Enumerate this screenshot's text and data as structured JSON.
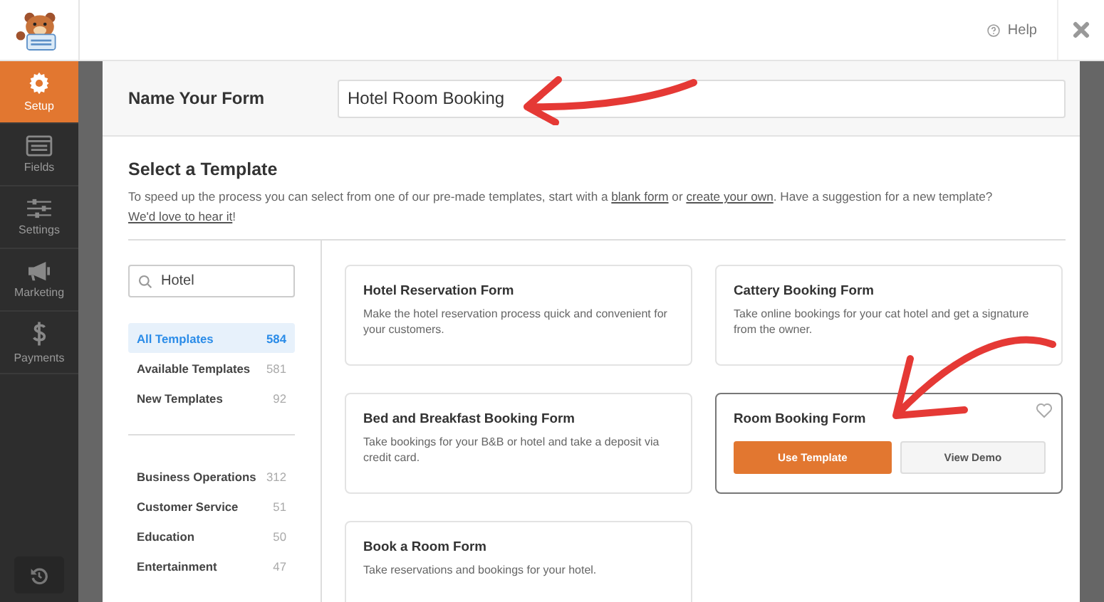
{
  "header": {
    "help": "Help"
  },
  "nav": [
    {
      "label": "Setup",
      "selected": true
    },
    {
      "label": "Fields",
      "selected": false
    },
    {
      "label": "Settings",
      "selected": false
    },
    {
      "label": "Marketing",
      "selected": false
    },
    {
      "label": "Payments",
      "selected": false
    }
  ],
  "name_form": {
    "label": "Name Your Form",
    "value": "Hotel Room Booking"
  },
  "template_section": {
    "title": "Select a Template",
    "description": [
      {
        "kind": "text",
        "text": "To speed up the process you can select from one of our pre-made templates, start with a "
      },
      {
        "kind": "link",
        "text": "blank form"
      },
      {
        "kind": "text",
        "text": " or "
      },
      {
        "kind": "link",
        "text": "create your own"
      },
      {
        "kind": "text",
        "text": ". Have a suggestion for a new template? "
      },
      {
        "kind": "link",
        "text": "We'd love to hear it"
      },
      {
        "kind": "text",
        "text": "!"
      }
    ]
  },
  "search": {
    "value": "Hotel"
  },
  "filters": [
    {
      "label": "All Templates",
      "count": "584",
      "selected": true
    },
    {
      "label": "Available Templates",
      "count": "581",
      "selected": false
    },
    {
      "label": "New Templates",
      "count": "92",
      "selected": false
    }
  ],
  "categories": [
    {
      "label": "Business Operations",
      "count": "312",
      "selected": false
    },
    {
      "label": "Customer Service",
      "count": "51",
      "selected": false
    },
    {
      "label": "Education",
      "count": "50",
      "selected": false
    },
    {
      "label": "Entertainment",
      "count": "47",
      "selected": false
    }
  ],
  "templates": [
    {
      "title": "Hotel Reservation Form",
      "description": "Make the hotel reservation process quick and convenient for your customers.",
      "hovered": false
    },
    {
      "title": "Cattery Booking Form",
      "description": "Take online bookings for your cat hotel and get a signature from the owner.",
      "hovered": false
    },
    {
      "title": "Bed and Breakfast Booking Form",
      "description": "Take bookings for your B&B or hotel and take a deposit via credit card.",
      "hovered": false
    },
    {
      "title": "Room Booking Form",
      "hovered": true,
      "use_button": "Use Template",
      "demo_button": "View Demo"
    },
    {
      "title": "Book a Room Form",
      "description": "Take reservations and bookings for your hotel.",
      "hovered": false
    }
  ]
}
